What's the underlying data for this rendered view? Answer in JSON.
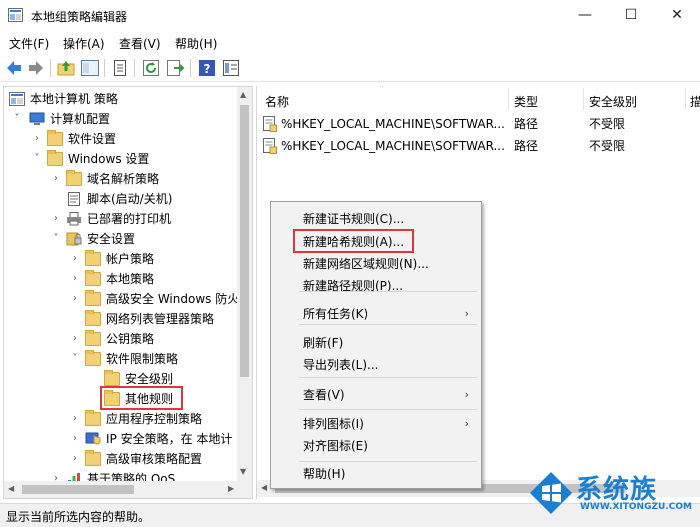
{
  "window": {
    "title": "本地组策略编辑器",
    "minimize": "—",
    "maximize": "☐",
    "close": "✕"
  },
  "menu": [
    "文件(F)",
    "操作(A)",
    "查看(V)",
    "帮助(H)"
  ],
  "tree": {
    "items": [
      {
        "label": "本地计算机 策略",
        "arrow": "",
        "icon": "computer-policy-icon"
      },
      {
        "label": "计算机配置",
        "arrow": "˅",
        "icon": "computer-icon"
      },
      {
        "label": "软件设置",
        "arrow": "›",
        "icon": "folder-icon"
      },
      {
        "label": "Windows 设置",
        "arrow": "˅",
        "icon": "folder-icon"
      },
      {
        "label": "域名解析策略",
        "arrow": "›",
        "icon": "folder-icon"
      },
      {
        "label": "脚本(启动/关机)",
        "arrow": "",
        "icon": "script-icon"
      },
      {
        "label": "已部署的打印机",
        "arrow": "›",
        "icon": "printer-icon"
      },
      {
        "label": "安全设置",
        "arrow": "˅",
        "icon": "security-icon"
      },
      {
        "label": "帐户策略",
        "arrow": "›",
        "icon": "folder-icon"
      },
      {
        "label": "本地策略",
        "arrow": "›",
        "icon": "folder-icon"
      },
      {
        "label": "高级安全 Windows 防火",
        "arrow": "›",
        "icon": "folder-icon"
      },
      {
        "label": "网络列表管理器策略",
        "arrow": "",
        "icon": "folder-icon"
      },
      {
        "label": "公钥策略",
        "arrow": "›",
        "icon": "folder-icon"
      },
      {
        "label": "软件限制策略",
        "arrow": "˅",
        "icon": "folder-icon"
      },
      {
        "label": "安全级别",
        "arrow": "",
        "icon": "folder-icon"
      },
      {
        "label": "其他规则",
        "arrow": "",
        "icon": "folder-icon"
      },
      {
        "label": "应用程序控制策略",
        "arrow": "›",
        "icon": "folder-icon"
      },
      {
        "label": "IP 安全策略，在 本地计",
        "arrow": "›",
        "icon": "ip-security-icon"
      },
      {
        "label": "高级审核策略配置",
        "arrow": "›",
        "icon": "folder-icon"
      },
      {
        "label": "基于策略的 QoS",
        "arrow": "›",
        "icon": "chart-icon"
      }
    ]
  },
  "list": {
    "columns": [
      "名称",
      "类型",
      "安全级别",
      "描"
    ],
    "rows": [
      {
        "name": "%HKEY_LOCAL_MACHINE\\SOFTWAR...",
        "type": "路径",
        "level": "不受限"
      },
      {
        "name": "%HKEY_LOCAL_MACHINE\\SOFTWAR...",
        "type": "路径",
        "level": "不受限"
      }
    ]
  },
  "context_menu": {
    "items": [
      {
        "label": "新建证书规则(C)...",
        "submenu": ""
      },
      {
        "label": "新建哈希规则(A)...",
        "submenu": ""
      },
      {
        "label": "新建网络区域规则(N)...",
        "submenu": ""
      },
      {
        "label": "新建路径规则(P)...",
        "submenu": ""
      },
      {
        "label": "所有任务(K)",
        "submenu": "›"
      },
      {
        "label": "刷新(F)",
        "submenu": ""
      },
      {
        "label": "导出列表(L)...",
        "submenu": ""
      },
      {
        "label": "查看(V)",
        "submenu": "›"
      },
      {
        "label": "排列图标(I)",
        "submenu": "›"
      },
      {
        "label": "对齐图标(E)",
        "submenu": ""
      },
      {
        "label": "帮助(H)",
        "submenu": ""
      }
    ]
  },
  "status": "显示当前所选内容的帮助。",
  "watermark": {
    "text": "系统族",
    "url": "WWW.XITONGZU.COM"
  },
  "colors": {
    "highlight_box": "#e0353c",
    "accent": "#1a7fd0",
    "folder": "#f1d173"
  }
}
